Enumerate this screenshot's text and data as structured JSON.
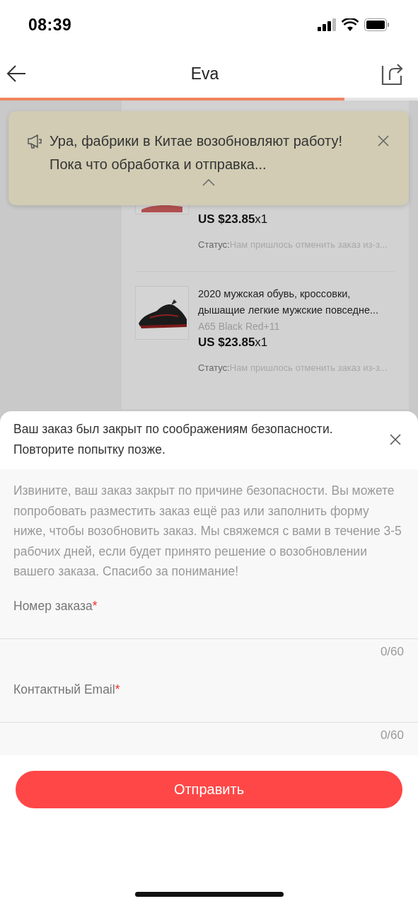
{
  "status_bar": {
    "time": "08:39"
  },
  "nav": {
    "title": "Eva",
    "progress": {
      "level": 0.824
    }
  },
  "banner": {
    "text": "Ура, фабрики в Китае возобновляют работу! Пока что обработка и отправка..."
  },
  "orders": [
    {
      "price": "US $23.85",
      "quantity": "x1",
      "status_label": "Статус:",
      "status": "Нам пришлось отменить заказ из-з..."
    },
    {
      "title": "2020 мужская обувь, кроссовки, дышащие легкие мужские повседне...",
      "variant": "A65 Black Red+11",
      "price": "US $23.85",
      "quantity": "x1",
      "status_label": "Статус:",
      "status": "Нам пришлось отменить заказ из-з..."
    }
  ],
  "sheet": {
    "title": "Ваш заказ был закрыт по соображениям безопасности. Повторите попытку позже.",
    "message": "Извините, ваш заказ закрыт по причине безопасности. Вы можете попробовать разместить заказ ещё раз или заполнить форму ниже, чтобы возобновить заказ. Мы свяжемся с вами в течение 3-5 рабочих дней, если будет принято решение о возобновлении вашего заказа. Спасибо за понимание!",
    "fields": [
      {
        "label": "Номер заказа",
        "required_mark": "*",
        "counter": "0/60"
      },
      {
        "label": "Контактный Email",
        "required_mark": "*",
        "counter": "0/60"
      }
    ],
    "submit": "Отправить"
  }
}
